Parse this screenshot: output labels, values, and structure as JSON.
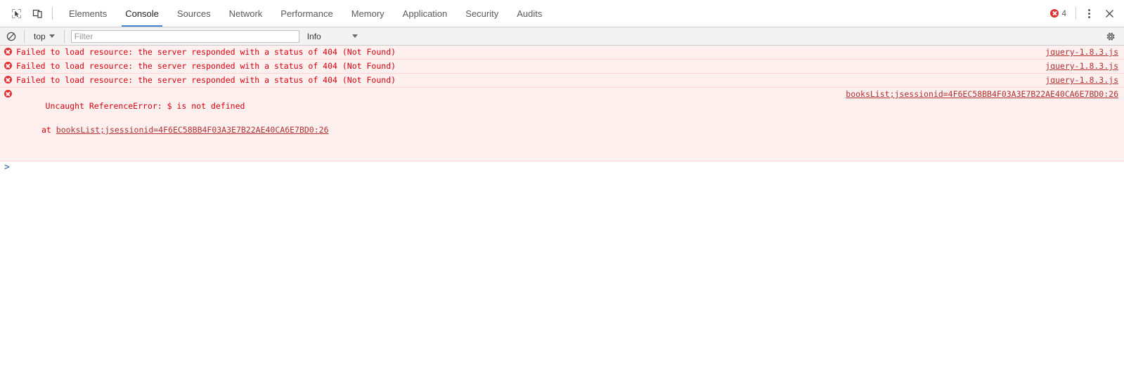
{
  "tabbar": {
    "inspect_icon": "inspect-cursor-icon",
    "device_icon": "device-toolbar-icon",
    "tabs": [
      {
        "label": "Elements",
        "active": false
      },
      {
        "label": "Console",
        "active": true
      },
      {
        "label": "Sources",
        "active": false
      },
      {
        "label": "Network",
        "active": false
      },
      {
        "label": "Performance",
        "active": false
      },
      {
        "label": "Memory",
        "active": false
      },
      {
        "label": "Application",
        "active": false
      },
      {
        "label": "Security",
        "active": false
      },
      {
        "label": "Audits",
        "active": false
      }
    ],
    "error_count": "4",
    "error_badge_color": "#e03131",
    "more_options_icon": "kebab-menu-icon",
    "close_icon": "close-icon",
    "active_tab_underline_color": "#4285d4"
  },
  "console_toolbar": {
    "clear_icon": "clear-console-icon",
    "context": "top",
    "context_caret_icon": "chevron-down-icon",
    "filter_placeholder": "Filter",
    "filter_value": "",
    "level": "Info",
    "level_caret_icon": "chevron-down-icon",
    "settings_icon": "gear-icon"
  },
  "messages": [
    {
      "icon": "error-icon",
      "text": "Failed to load resource: the server responded with a status of 404 (Not Found)",
      "source": "jquery-1.8.3.js",
      "stack": "",
      "stack_link": ""
    },
    {
      "icon": "error-icon",
      "text": "Failed to load resource: the server responded with a status of 404 (Not Found)",
      "source": "jquery-1.8.3.js",
      "stack": "",
      "stack_link": ""
    },
    {
      "icon": "error-icon",
      "text": "Failed to load resource: the server responded with a status of 404 (Not Found)",
      "source": "jquery-1.8.3.js",
      "stack": "",
      "stack_link": ""
    },
    {
      "icon": "error-icon",
      "text": "Uncaught ReferenceError: $ is not defined",
      "source": "booksList;jsessionid=4F6EC58BB4F03A3E7B22AE40CA6E7BD0:26",
      "stack_prefix": "at ",
      "stack_link": "booksList;jsessionid=4F6EC58BB4F03A3E7B22AE40CA6E7BD0:26"
    }
  ],
  "prompt": {
    "chevron": ">",
    "value": "",
    "placeholder": ""
  },
  "colors": {
    "error_text": "#d8000c",
    "error_row_bg": "#fff0f0",
    "error_row_border": "#ffd6d6",
    "toolbar_bg": "#f3f3f3",
    "prompt_chevron": "#5a7fb5"
  }
}
